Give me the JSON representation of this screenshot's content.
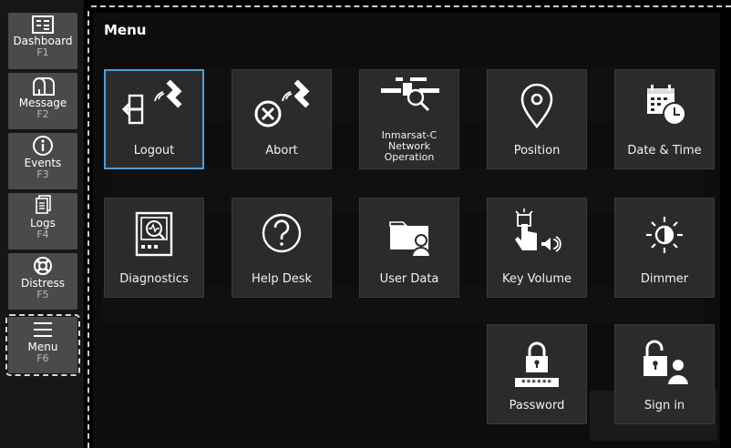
{
  "sidebar": {
    "items": [
      {
        "label": "Dashboard",
        "key": "F1",
        "icon": "dashboard-icon"
      },
      {
        "label": "Message",
        "key": "F2",
        "icon": "mailbox-icon"
      },
      {
        "label": "Events",
        "key": "F3",
        "icon": "info-icon"
      },
      {
        "label": "Logs",
        "key": "F4",
        "icon": "logs-icon"
      },
      {
        "label": "Distress",
        "key": "F5",
        "icon": "lifebuoy-icon"
      },
      {
        "label": "Menu",
        "key": "F6",
        "icon": "hamburger-icon",
        "active": true
      }
    ]
  },
  "panel": {
    "title": "Menu",
    "tiles": [
      {
        "label": "Logout",
        "icon": "logout-satellite-icon",
        "selected": true
      },
      {
        "label": "Abort",
        "icon": "abort-satellite-icon"
      },
      {
        "label_lines": [
          "Inmarsat-C",
          "Network",
          "Operation"
        ],
        "icon": "network-search-icon"
      },
      {
        "label": "Position",
        "icon": "location-pin-icon"
      },
      {
        "label": "Date & Time",
        "icon": "calendar-clock-icon"
      },
      {
        "label": "Diagnostics",
        "icon": "diagnostics-icon"
      },
      {
        "label": "Help Desk",
        "icon": "question-icon"
      },
      {
        "label": "User Data",
        "icon": "folder-user-icon"
      },
      {
        "label": "Key Volume",
        "icon": "key-volume-icon"
      },
      {
        "label": "Dimmer",
        "icon": "brightness-icon"
      },
      {
        "label": "Password",
        "icon": "lock-password-icon",
        "mask": "******"
      },
      {
        "label": "Sign in",
        "icon": "unlock-user-icon"
      }
    ]
  },
  "colors": {
    "tile_bg": "#2b2b2b",
    "selected_border": "#4f9ed6",
    "sidebar_btn": "#4a4a4a"
  }
}
